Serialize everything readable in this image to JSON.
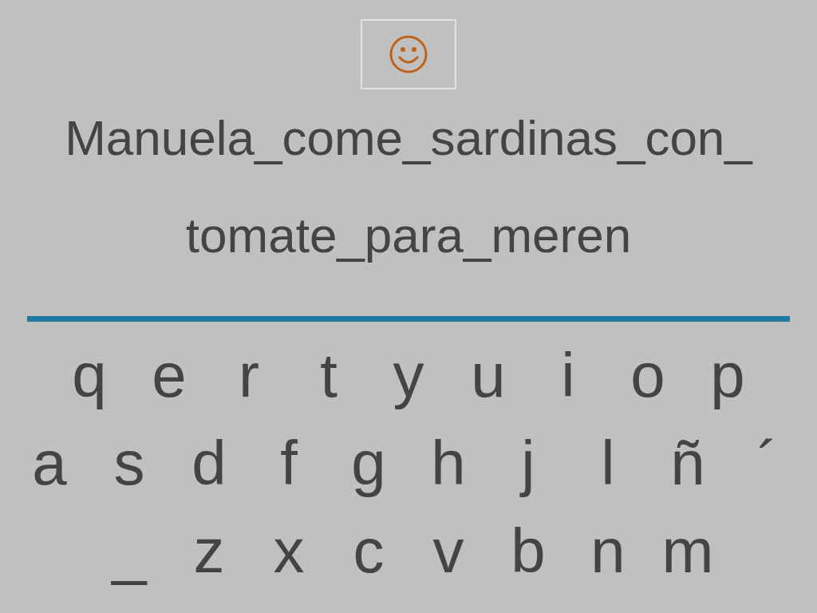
{
  "sentence": {
    "lines": [
      "Manuela_come_sardinas_con_",
      "tomate_para_meren"
    ]
  },
  "keyboard": {
    "rows": [
      [
        "q",
        "e",
        "r",
        "t",
        "y",
        "u",
        "i",
        "o",
        "p"
      ],
      [
        "a",
        "s",
        "d",
        "f",
        "g",
        "h",
        "j",
        "l",
        "ñ",
        "´"
      ],
      [
        "_",
        "z",
        "x",
        "c",
        "v",
        "b",
        "n",
        "m"
      ]
    ]
  }
}
